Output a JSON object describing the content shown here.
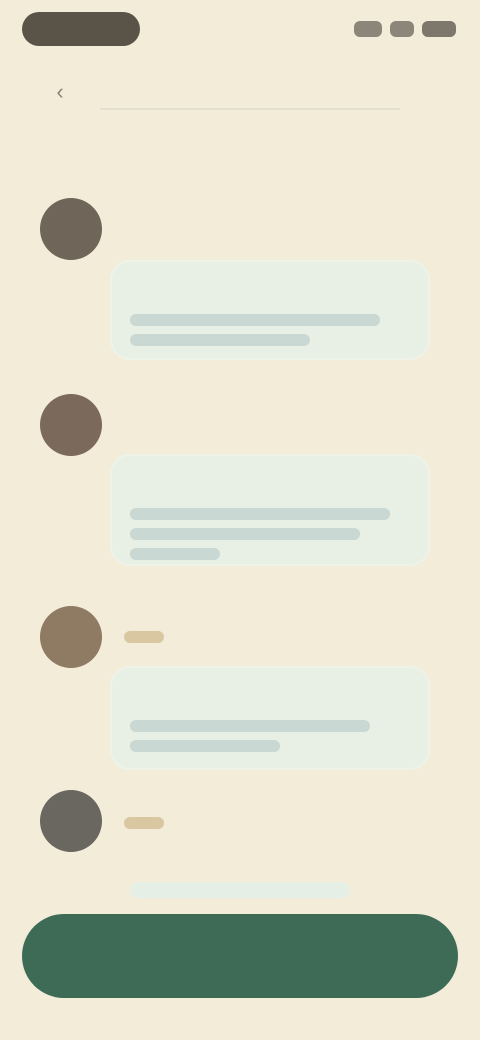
{
  "status_bar": {
    "signal_icon": "signal-icon",
    "wifi_icon": "wifi-icon",
    "battery_icon": "battery-icon"
  },
  "header": {
    "back_icon": "back-arrow-icon",
    "title": "",
    "page_title": ""
  },
  "list": {
    "items": [
      {
        "name": "",
        "card_title": ""
      },
      {
        "name": "",
        "card_title": ""
      },
      {
        "name": "",
        "card_title": ""
      },
      {
        "name": ""
      }
    ]
  },
  "bottom": {
    "action_label": ""
  },
  "colors": {
    "background": "#f3ecd8",
    "accent_green": "#3e6b55",
    "card_bg": "#e8efe5"
  }
}
